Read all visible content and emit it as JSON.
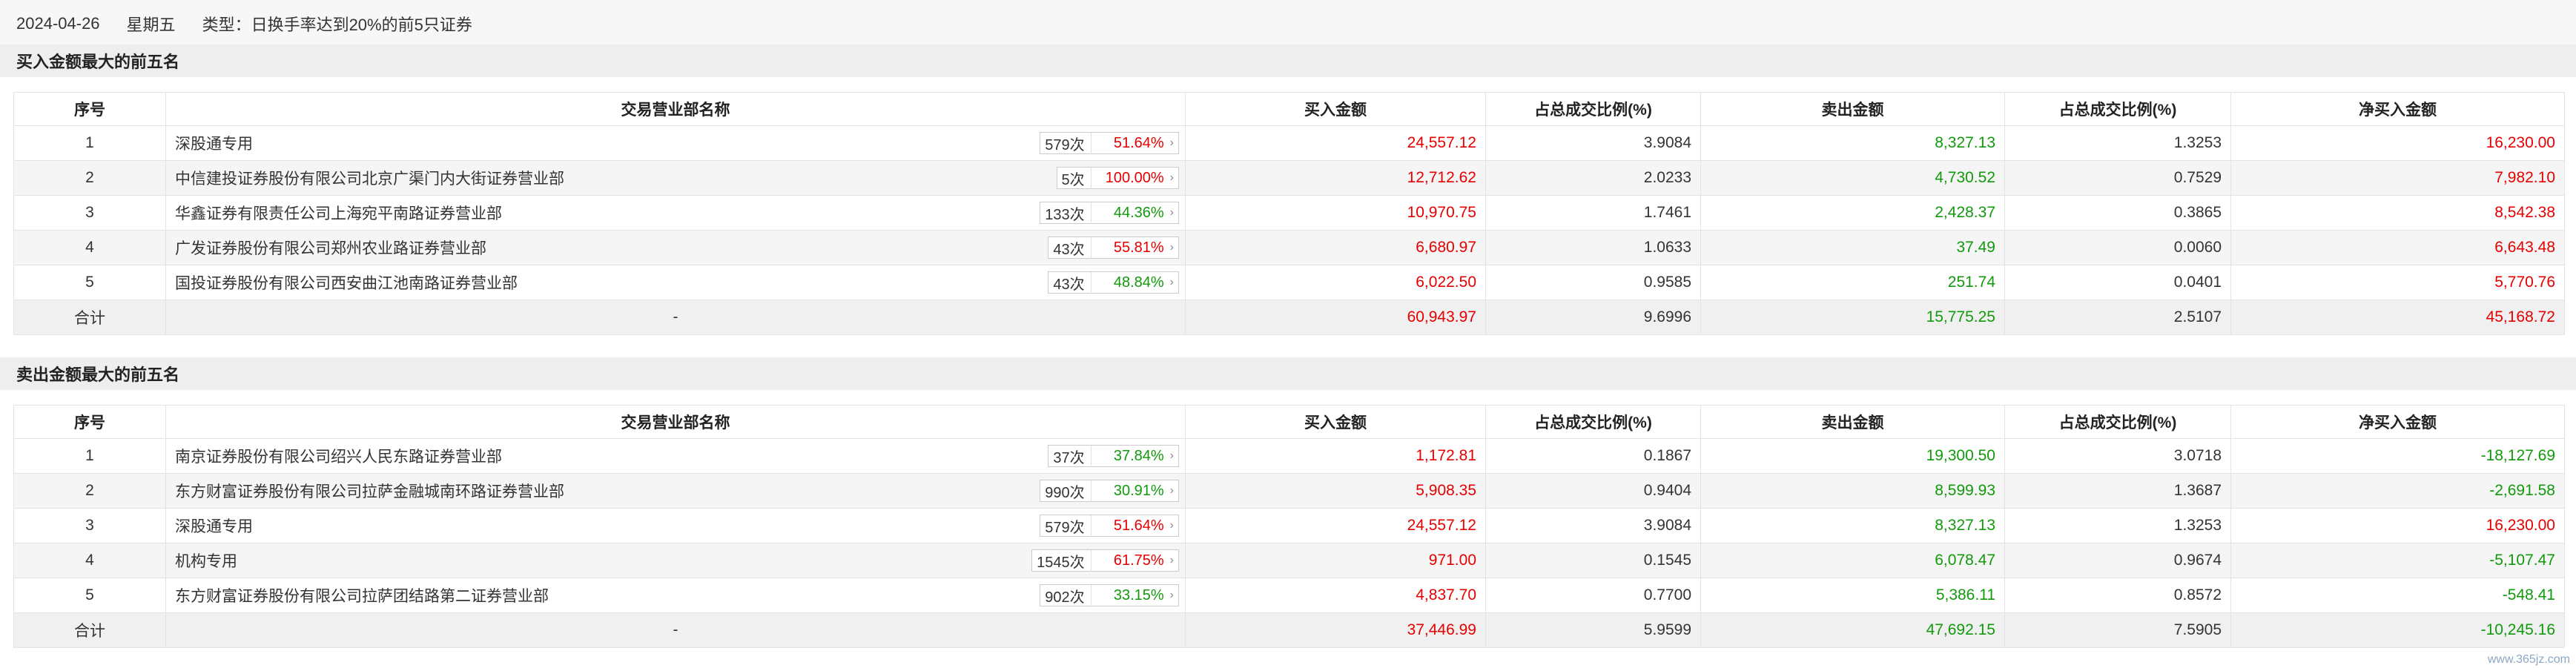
{
  "info": {
    "date": "2024-04-26",
    "weekday": "星期五",
    "type": "类型：日换手率达到20%的前5只证券"
  },
  "sections": {
    "buy": {
      "title": "买入金额最大的前五名"
    },
    "sell": {
      "title": "卖出金额最大的前五名"
    }
  },
  "columns": [
    "序号",
    "交易营业部名称",
    "买入金额",
    "占总成交比例(%)",
    "卖出金额",
    "占总成交比例(%)",
    "净买入金额"
  ],
  "colors": {
    "up": "#e60000",
    "down": "#119a0c"
  },
  "icons": {
    "badge_arrow": "chevron-right-icon"
  },
  "buy_rows": [
    {
      "no": "1",
      "name": "深股通专用",
      "count": "579次",
      "pct": "51.64%",
      "pct_color": "red",
      "buy": "24,557.12",
      "buy_ratio": "3.9084",
      "sell": "8,327.13",
      "sell_ratio": "1.3253",
      "net": "16,230.00",
      "net_color": "red"
    },
    {
      "no": "2",
      "name": "中信建投证券股份有限公司北京广渠门内大街证券营业部",
      "count": "5次",
      "pct": "100.00%",
      "pct_color": "red",
      "buy": "12,712.62",
      "buy_ratio": "2.0233",
      "sell": "4,730.52",
      "sell_ratio": "0.7529",
      "net": "7,982.10",
      "net_color": "red"
    },
    {
      "no": "3",
      "name": "华鑫证券有限责任公司上海宛平南路证券营业部",
      "count": "133次",
      "pct": "44.36%",
      "pct_color": "green",
      "buy": "10,970.75",
      "buy_ratio": "1.7461",
      "sell": "2,428.37",
      "sell_ratio": "0.3865",
      "net": "8,542.38",
      "net_color": "red"
    },
    {
      "no": "4",
      "name": "广发证券股份有限公司郑州农业路证券营业部",
      "count": "43次",
      "pct": "55.81%",
      "pct_color": "red",
      "buy": "6,680.97",
      "buy_ratio": "1.0633",
      "sell": "37.49",
      "sell_ratio": "0.0060",
      "net": "6,643.48",
      "net_color": "red"
    },
    {
      "no": "5",
      "name": "国投证券股份有限公司西安曲江池南路证券营业部",
      "count": "43次",
      "pct": "48.84%",
      "pct_color": "green",
      "buy": "6,022.50",
      "buy_ratio": "0.9585",
      "sell": "251.74",
      "sell_ratio": "0.0401",
      "net": "5,770.76",
      "net_color": "red"
    }
  ],
  "buy_total": {
    "label": "合计",
    "name": "-",
    "buy": "60,943.97",
    "buy_ratio": "9.6996",
    "sell": "15,775.25",
    "sell_ratio": "2.5107",
    "net": "45,168.72",
    "net_color": "red"
  },
  "sell_rows": [
    {
      "no": "1",
      "name": "南京证券股份有限公司绍兴人民东路证券营业部",
      "count": "37次",
      "pct": "37.84%",
      "pct_color": "green",
      "buy": "1,172.81",
      "buy_ratio": "0.1867",
      "sell": "19,300.50",
      "sell_ratio": "3.0718",
      "net": "-18,127.69",
      "net_color": "green"
    },
    {
      "no": "2",
      "name": "东方财富证券股份有限公司拉萨金融城南环路证券营业部",
      "count": "990次",
      "pct": "30.91%",
      "pct_color": "green",
      "buy": "5,908.35",
      "buy_ratio": "0.9404",
      "sell": "8,599.93",
      "sell_ratio": "1.3687",
      "net": "-2,691.58",
      "net_color": "green"
    },
    {
      "no": "3",
      "name": "深股通专用",
      "count": "579次",
      "pct": "51.64%",
      "pct_color": "red",
      "buy": "24,557.12",
      "buy_ratio": "3.9084",
      "sell": "8,327.13",
      "sell_ratio": "1.3253",
      "net": "16,230.00",
      "net_color": "red"
    },
    {
      "no": "4",
      "name": "机构专用",
      "count": "1545次",
      "pct": "61.75%",
      "pct_color": "red",
      "buy": "971.00",
      "buy_ratio": "0.1545",
      "sell": "6,078.47",
      "sell_ratio": "0.9674",
      "net": "-5,107.47",
      "net_color": "green"
    },
    {
      "no": "5",
      "name": "东方财富证券股份有限公司拉萨团结路第二证券营业部",
      "count": "902次",
      "pct": "33.15%",
      "pct_color": "green",
      "buy": "4,837.70",
      "buy_ratio": "0.7700",
      "sell": "5,386.11",
      "sell_ratio": "0.8572",
      "net": "-548.41",
      "net_color": "green"
    }
  ],
  "sell_total": {
    "label": "合计",
    "name": "-",
    "buy": "37,446.99",
    "buy_ratio": "5.9599",
    "sell": "47,692.15",
    "sell_ratio": "7.5905",
    "net": "-10,245.16",
    "net_color": "green"
  },
  "watermark": "www.365jz.com"
}
